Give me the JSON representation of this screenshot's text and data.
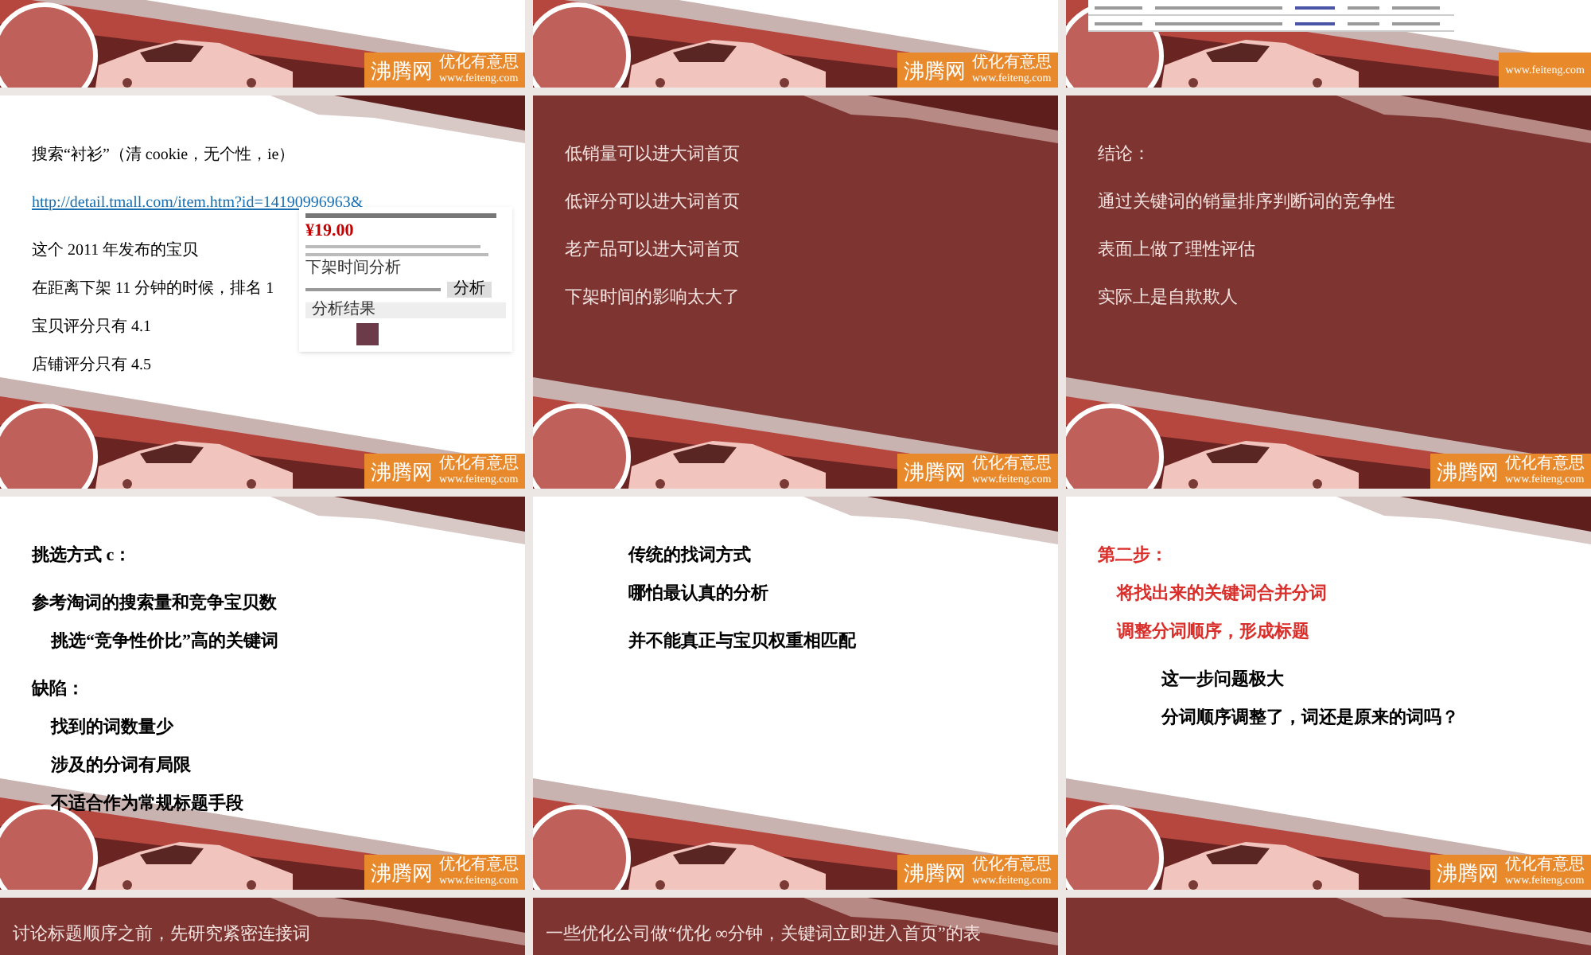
{
  "rows": [
    {
      "kind": "lower_part",
      "slides": [
        {
          "kind": "light",
          "logo": {
            "name": "沸腾网",
            "slogan": "优化有意思",
            "site": "www.feiteng.com"
          }
        },
        {
          "kind": "light",
          "logo": {
            "name": "沸腾网",
            "slogan": "优化有意思",
            "site": "www.feiteng.com"
          }
        },
        {
          "kind": "light",
          "inset": {
            "kind": "table"
          },
          "logo": {
            "site": "www.feiteng.com"
          }
        }
      ]
    },
    {
      "kind": "whole",
      "slides": [
        {
          "kind": "light",
          "groups": [
            {
              "kind": "plain",
              "lines": [
                {
                  "kind": "text",
                  "text": "搜索“衬衫”（清 cookie，无个性，ie）",
                  "emphasis": false
                }
              ]
            },
            {
              "kind": "plain",
              "lines": [
                {
                  "kind": "link",
                  "text": "http://detail.tmall.com/item.htm?id=14190996963&"
                }
              ]
            },
            {
              "kind": "plain",
              "lines": [
                {
                  "kind": "text",
                  "text": "这个 2011 年发布的宝贝",
                  "emphasis": false
                },
                {
                  "kind": "text",
                  "text": "在距离下架 11 分钟的时候，排名 1",
                  "emphasis": false
                },
                {
                  "kind": "text",
                  "text": "宝贝评分只有 4.1",
                  "emphasis": false
                },
                {
                  "kind": "text",
                  "text": "店铺评分只有 4.5",
                  "emphasis": false
                }
              ]
            }
          ],
          "inset": {
            "kind": "product",
            "price": "¥19.00",
            "section_title": "下架时间分析",
            "button": "分析",
            "result_header": "分析结果"
          },
          "logo": {
            "name": "沸腾网",
            "slogan": "优化有意思",
            "site": "www.feiteng.com"
          }
        },
        {
          "kind": "dark",
          "groups": [
            {
              "kind": "plain",
              "lines": [
                {
                  "kind": "text",
                  "text": "低销量可以进大词首页",
                  "emphasis": false
                }
              ]
            },
            {
              "kind": "plain",
              "lines": [
                {
                  "kind": "text",
                  "text": "低评分可以进大词首页",
                  "emphasis": false
                }
              ]
            },
            {
              "kind": "plain",
              "lines": [
                {
                  "kind": "text",
                  "text": "老产品可以进大词首页",
                  "emphasis": false
                }
              ]
            },
            {
              "kind": "plain",
              "lines": [
                {
                  "kind": "text",
                  "text": "下架时间的影响太大了",
                  "emphasis": false
                }
              ]
            }
          ],
          "logo": {
            "name": "沸腾网",
            "slogan": "优化有意思",
            "site": "www.feiteng.com"
          }
        },
        {
          "kind": "dark",
          "groups": [
            {
              "kind": "plain",
              "lines": [
                {
                  "kind": "text",
                  "text": "结论：",
                  "emphasis": false
                }
              ]
            },
            {
              "kind": "plain",
              "lines": [
                {
                  "kind": "text",
                  "text": "通过关键词的销量排序判断词的竞争性",
                  "emphasis": false
                }
              ]
            },
            {
              "kind": "plain",
              "lines": [
                {
                  "kind": "text",
                  "text": "表面上做了理性评估",
                  "emphasis": false
                }
              ]
            },
            {
              "kind": "plain",
              "lines": [
                {
                  "kind": "text",
                  "text": "实际上是自欺欺人",
                  "emphasis": false
                }
              ]
            }
          ],
          "logo": {
            "name": "沸腾网",
            "slogan": "优化有意思",
            "site": "www.feiteng.com"
          }
        }
      ]
    },
    {
      "kind": "whole",
      "slides": [
        {
          "kind": "light_bold",
          "groups": [
            {
              "kind": "plain",
              "lines": [
                {
                  "kind": "text",
                  "text": "挑选方式 c：",
                  "emphasis": false
                }
              ]
            },
            {
              "kind": "plain",
              "lines": [
                {
                  "kind": "text",
                  "text": "参考淘词的搜索量和竞争宝贝数",
                  "emphasis": false,
                  "children": [
                    {
                      "kind": "text",
                      "text": "挑选“竞争性价比”高的关键词",
                      "emphasis": false
                    }
                  ]
                }
              ]
            },
            {
              "kind": "plain",
              "lines": [
                {
                  "kind": "text",
                  "text": "缺陷：",
                  "emphasis": false,
                  "children": [
                    {
                      "kind": "text",
                      "text": "找到的词数量少",
                      "emphasis": false
                    },
                    {
                      "kind": "text",
                      "text": "涉及的分词有局限",
                      "emphasis": false
                    },
                    {
                      "kind": "text",
                      "text": "不适合作为常规标题手段",
                      "emphasis": false
                    }
                  ]
                }
              ]
            }
          ],
          "logo": {
            "name": "沸腾网",
            "slogan": "优化有意思",
            "site": "www.feiteng.com"
          }
        },
        {
          "kind": "light_bold",
          "groups": [
            {
              "kind": "indented",
              "lines": [
                {
                  "kind": "text",
                  "text": "传统的找词方式",
                  "emphasis": false
                },
                {
                  "kind": "text",
                  "text": "哪怕最认真的分析",
                  "emphasis": false
                }
              ]
            },
            {
              "kind": "indented",
              "lines": [
                {
                  "kind": "text",
                  "text": "并不能真正与宝贝权重相匹配",
                  "emphasis": false
                }
              ]
            }
          ],
          "logo": {
            "name": "沸腾网",
            "slogan": "优化有意思",
            "site": "www.feiteng.com"
          }
        },
        {
          "kind": "light_bold",
          "groups": [
            {
              "kind": "plain",
              "lines": [
                {
                  "kind": "text",
                  "text": "第二步：",
                  "emphasis": true,
                  "children": [
                    {
                      "kind": "text",
                      "text": "将找出来的关键词合并分词",
                      "emphasis": true
                    },
                    {
                      "kind": "text",
                      "text": "调整分词顺序，形成标题",
                      "emphasis": true
                    }
                  ]
                }
              ]
            },
            {
              "kind": "indented",
              "lines": [
                {
                  "kind": "text",
                  "text": "这一步问题极大",
                  "emphasis": false
                },
                {
                  "kind": "text",
                  "text": "分词顺序调整了，词还是原来的词吗？",
                  "emphasis": false
                }
              ]
            }
          ],
          "logo": {
            "name": "沸腾网",
            "slogan": "优化有意思",
            "site": "www.feiteng.com"
          }
        }
      ]
    },
    {
      "kind": "upper_part",
      "slides": [
        {
          "kind": "dark",
          "groups": [
            {
              "kind": "plain",
              "lines": [
                {
                  "kind": "text",
                  "text": "讨论标题顺序之前，先研究紧密连接词",
                  "emphasis": false
                }
              ]
            }
          ]
        },
        {
          "kind": "dark",
          "groups": [
            {
              "kind": "plain",
              "lines": [
                {
                  "kind": "text",
                  "text": "一些优化公司做“优化 ∞分钟，关键词立即进入首页”的表",
                  "emphasis": false
                }
              ]
            }
          ]
        },
        {
          "kind": "dark"
        }
      ]
    }
  ]
}
